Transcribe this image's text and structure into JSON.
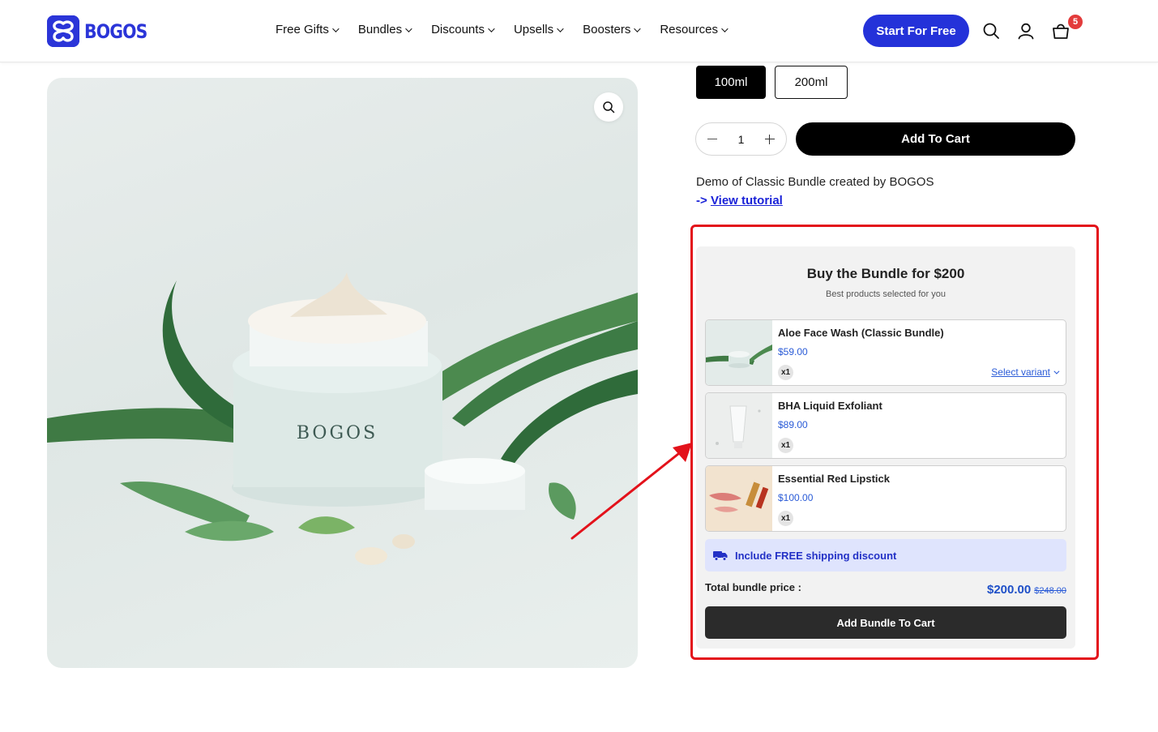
{
  "header": {
    "logo_text": "BOGOS",
    "nav": [
      {
        "label": "Free Gifts"
      },
      {
        "label": "Bundles"
      },
      {
        "label": "Discounts"
      },
      {
        "label": "Upsells"
      },
      {
        "label": "Boosters"
      },
      {
        "label": "Resources"
      }
    ],
    "cta_label": "Start For Free",
    "cart_count": "5",
    "icons": [
      "search-icon",
      "account-icon",
      "cart-icon"
    ],
    "accent_color": "#2432d9"
  },
  "product": {
    "image_brand_text": "BOGOS",
    "variants": [
      {
        "label": "100ml",
        "selected": true
      },
      {
        "label": "200ml",
        "selected": false
      }
    ],
    "quantity": "1",
    "add_to_cart_label": "Add To Cart",
    "description": "Demo of Classic Bundle created by BOGOS",
    "tutorial_prefix": "->",
    "tutorial_label": "View tutorial"
  },
  "bundle": {
    "title": "Buy the Bundle for $200",
    "subtitle": "Best products selected for you",
    "items": [
      {
        "name": "Aloe Face Wash (Classic Bundle)",
        "price": "$59.00",
        "qty": "x1",
        "select_variant": "Select variant"
      },
      {
        "name": "BHA Liquid Exfoliant",
        "price": "$89.00",
        "qty": "x1"
      },
      {
        "name": "Essential Red Lipstick",
        "price": "$100.00",
        "qty": "x1"
      }
    ],
    "shipping_text": "Include FREE shipping discount",
    "total_label": "Total bundle price :",
    "total_price": "$200.00",
    "original_price": "$248.00",
    "add_bundle_label": "Add Bundle To Cart",
    "highlight_color": "#e3121b"
  }
}
